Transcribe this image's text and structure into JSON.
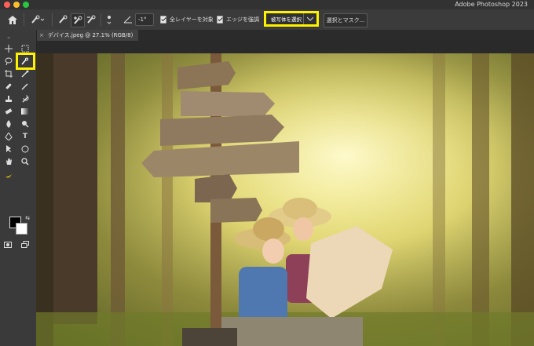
{
  "app": {
    "title": "Adobe Photoshop 2023"
  },
  "options_bar": {
    "angle": "-1°",
    "sample_all_layers_label": "全レイヤーを対象",
    "enhance_edge_label": "エッジを強調",
    "select_subject_label": "被写体を選択",
    "select_and_mask_label": "選択とマスク..."
  },
  "document": {
    "tab_title": "デバイス.jpeg @ 27.1% (RGB/8)"
  },
  "colors": {
    "highlight": "#fff200",
    "foreground": "#000000",
    "background": "#ffffff"
  }
}
